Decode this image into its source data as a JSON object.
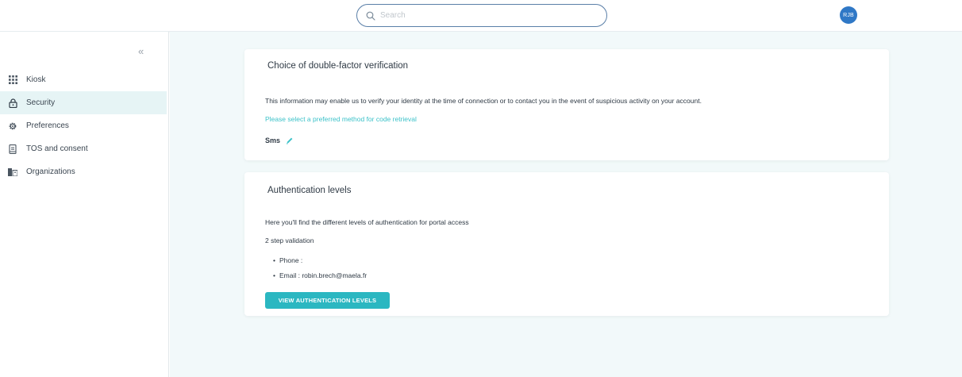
{
  "search": {
    "placeholder": "Search",
    "value": ""
  },
  "user": {
    "initials": "RJB"
  },
  "sidebar": {
    "collapse_glyph": "«",
    "items": [
      {
        "label": "Kiosk",
        "icon": "grid-icon",
        "active": false
      },
      {
        "label": "Security",
        "icon": "lock-icon",
        "active": true
      },
      {
        "label": "Preferences",
        "icon": "gear-icon",
        "active": false
      },
      {
        "label": "TOS and consent",
        "icon": "document-icon",
        "active": false
      },
      {
        "label": "Organizations",
        "icon": "building-icon",
        "active": false
      }
    ]
  },
  "two_factor": {
    "title": "Choice of double-factor verification",
    "description": "This information may enable us to verify your identity at the time of connection or to contact you in the event of suspicious activity on your account.",
    "select_prompt": "Please select a preferred method for code retrieval",
    "method": "Sms"
  },
  "auth_levels": {
    "title": "Authentication levels",
    "description": "Here you'll find the different levels of authentication for portal access",
    "level_name": "2 step validation",
    "phone_label": "Phone :",
    "email_label": "Email : robin.brech@maela.fr",
    "button_label": "VIEW AUTHENTICATION LEVELS"
  },
  "colors": {
    "accent": "#2bb7c1",
    "link": "#3cc2c9",
    "avatar": "#2f78c6",
    "active_bg": "#e6f4f5",
    "main_bg": "#f2f9fa"
  }
}
